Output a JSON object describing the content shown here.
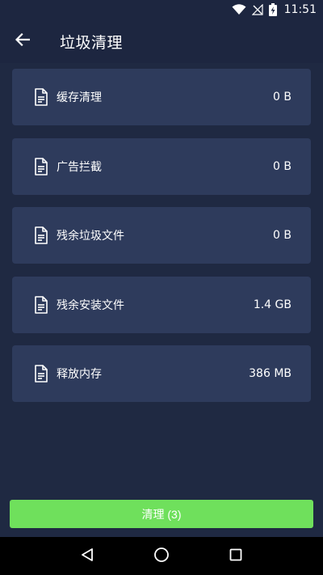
{
  "status_bar": {
    "time": "11:51"
  },
  "header": {
    "title": "垃圾清理"
  },
  "items": [
    {
      "label": "缓存清理",
      "value": "0 B"
    },
    {
      "label": "广告拦截",
      "value": "0 B"
    },
    {
      "label": "残余垃圾文件",
      "value": "0 B"
    },
    {
      "label": "残余安装文件",
      "value": "1.4 GB"
    },
    {
      "label": "释放内存",
      "value": "386 MB"
    }
  ],
  "clean_button": {
    "label": "清理 (3)"
  },
  "colors": {
    "background": "#1f2942",
    "card": "#2e3b5c",
    "accent_green": "#6fe05c",
    "navbar": "#000000"
  }
}
